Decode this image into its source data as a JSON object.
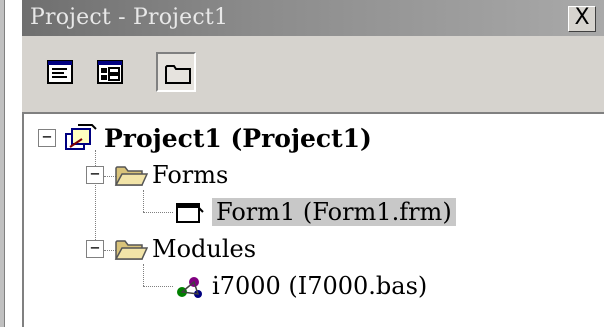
{
  "window": {
    "title": "Project - Project1",
    "close_label": "X"
  },
  "toolbar": {
    "buttons": [
      {
        "name": "view-code-button",
        "icon": "view-code-icon"
      },
      {
        "name": "view-object-button",
        "icon": "view-object-icon"
      },
      {
        "name": "toggle-folders-button",
        "icon": "folder-icon",
        "pressed": true
      }
    ]
  },
  "tree": {
    "project": {
      "label": "Project1 (Project1)",
      "expanded": true,
      "icon": "project-icon"
    },
    "forms_folder": {
      "label": "Forms",
      "expanded": true,
      "icon": "folder-open-icon"
    },
    "form1": {
      "label": "Form1 (Form1.frm)",
      "selected": true,
      "icon": "form-icon"
    },
    "modules_folder": {
      "label": "Modules",
      "expanded": true,
      "icon": "folder-open-icon"
    },
    "module1": {
      "label": "i7000 (I7000.bas)",
      "icon": "module-icon"
    },
    "collapse_symbol": "−"
  }
}
